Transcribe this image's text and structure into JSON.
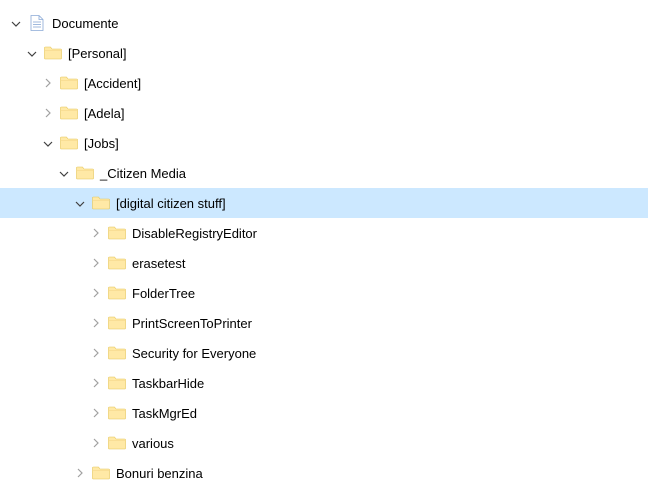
{
  "tree": {
    "items": [
      {
        "depth": 0,
        "expanded": true,
        "iconType": "doc",
        "label": "Documente",
        "selected": false
      },
      {
        "depth": 1,
        "expanded": true,
        "iconType": "folder",
        "label": "[Personal]",
        "selected": false
      },
      {
        "depth": 2,
        "expanded": false,
        "iconType": "folder",
        "label": "[Accident]",
        "selected": false
      },
      {
        "depth": 2,
        "expanded": false,
        "iconType": "folder",
        "label": "[Adela]",
        "selected": false
      },
      {
        "depth": 2,
        "expanded": true,
        "iconType": "folder",
        "label": "[Jobs]",
        "selected": false
      },
      {
        "depth": 3,
        "expanded": true,
        "iconType": "folder",
        "label": "_Citizen Media",
        "selected": false
      },
      {
        "depth": 4,
        "expanded": true,
        "iconType": "folder",
        "label": "[digital citizen stuff]",
        "selected": true
      },
      {
        "depth": 5,
        "expanded": false,
        "iconType": "folder",
        "label": "DisableRegistryEditor",
        "selected": false
      },
      {
        "depth": 5,
        "expanded": false,
        "iconType": "folder",
        "label": "erasetest",
        "selected": false
      },
      {
        "depth": 5,
        "expanded": false,
        "iconType": "folder",
        "label": "FolderTree",
        "selected": false
      },
      {
        "depth": 5,
        "expanded": false,
        "iconType": "folder",
        "label": "PrintScreenToPrinter",
        "selected": false
      },
      {
        "depth": 5,
        "expanded": false,
        "iconType": "folder",
        "label": "Security for Everyone",
        "selected": false
      },
      {
        "depth": 5,
        "expanded": false,
        "iconType": "folder",
        "label": "TaskbarHide",
        "selected": false
      },
      {
        "depth": 5,
        "expanded": false,
        "iconType": "folder",
        "label": "TaskMgrEd",
        "selected": false
      },
      {
        "depth": 5,
        "expanded": false,
        "iconType": "folder",
        "label": "various",
        "selected": false
      },
      {
        "depth": 4,
        "expanded": false,
        "iconType": "folder",
        "label": "Bonuri benzina",
        "selected": false
      }
    ]
  }
}
